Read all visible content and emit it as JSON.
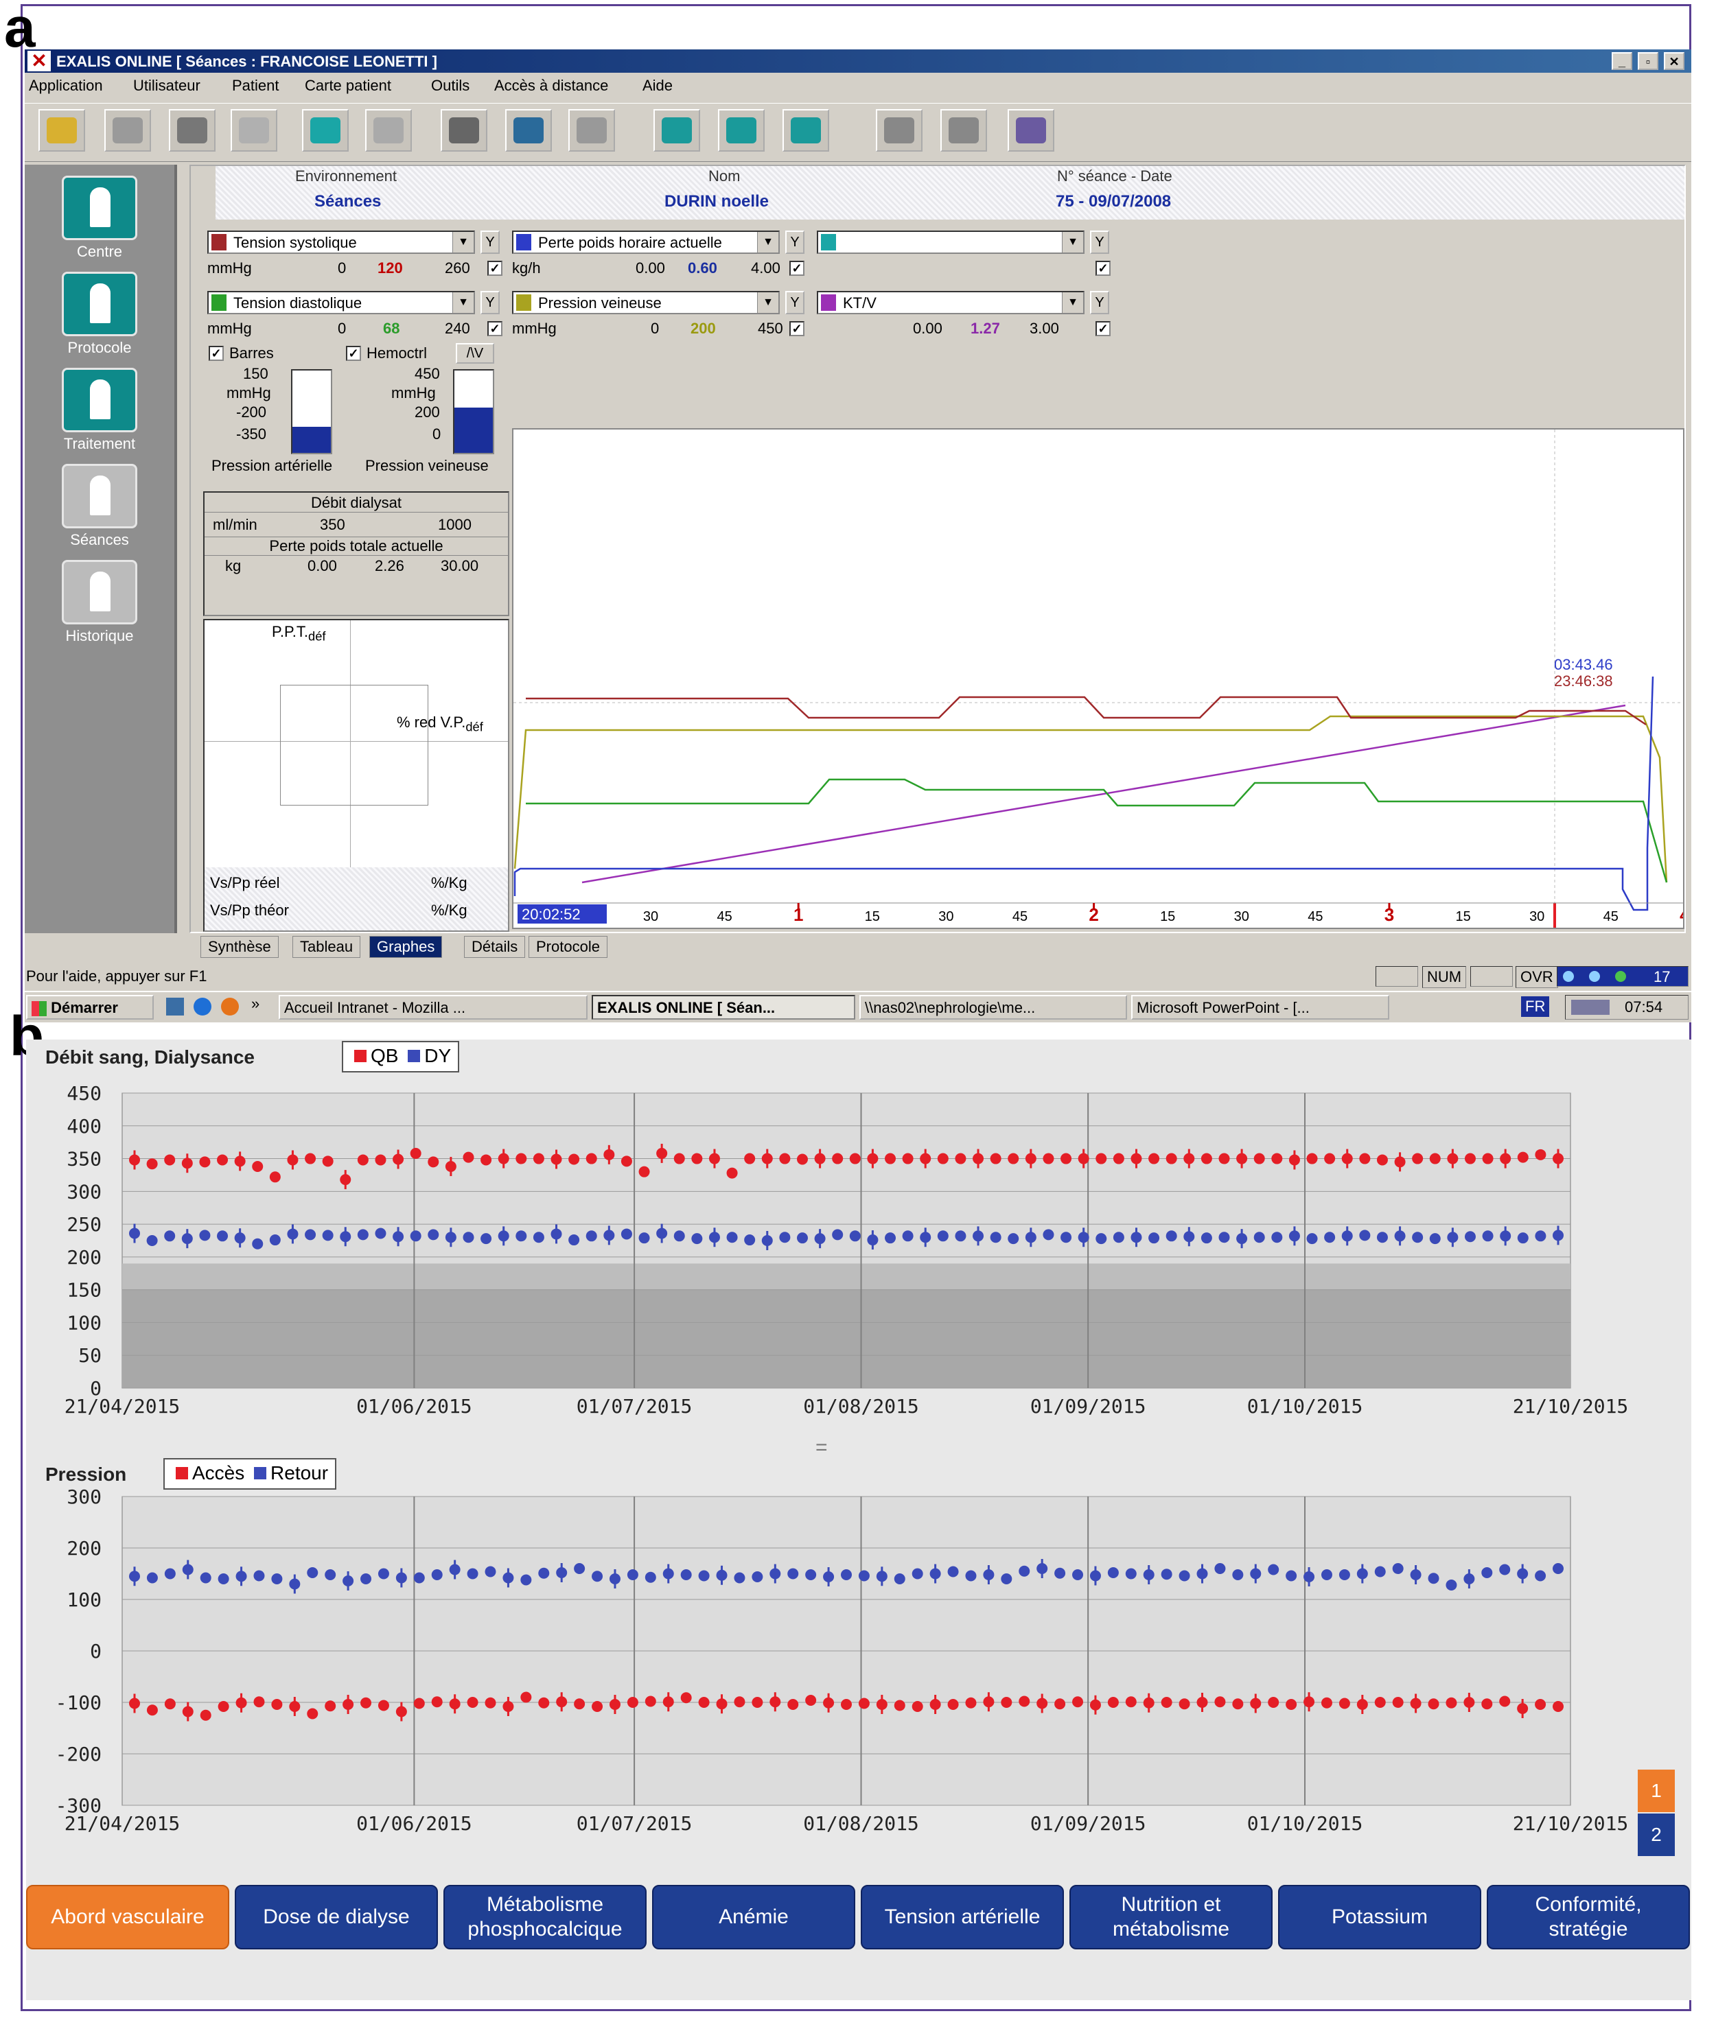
{
  "labels": {
    "a": "a",
    "b": "b"
  },
  "window": {
    "title": "EXALIS ONLINE [ Séances : FRANCOISE LEONETTI ]",
    "min": "_",
    "restore": "▫",
    "close": "✕",
    "menu": [
      "Application",
      "Utilisateur",
      "Patient",
      "Carte patient",
      "Outils",
      "Accès à distance",
      "Aide"
    ]
  },
  "sidebar": {
    "items": [
      {
        "label": "Centre",
        "icon": "centre-icon"
      },
      {
        "label": "Protocole",
        "icon": "protocole-icon"
      },
      {
        "label": "Traitement",
        "icon": "traitement-icon"
      },
      {
        "label": "Séances",
        "icon": "seances-icon"
      },
      {
        "label": "Historique",
        "icon": "historique-icon"
      }
    ]
  },
  "header": {
    "env_label": "Environnement",
    "env_value": "Séances",
    "nom_label": "Nom",
    "nom_value": "DURIN noelle",
    "seance_label": "N° séance - Date",
    "seance_value": "75 - 09/07/2008"
  },
  "params": {
    "systolique": {
      "name": "Tension systolique",
      "unit": "mmHg",
      "min": "0",
      "val": "120",
      "max": "260"
    },
    "diastolique": {
      "name": "Tension diastolique",
      "unit": "mmHg",
      "min": "0",
      "val": "68",
      "max": "240"
    },
    "perte": {
      "name": "Perte poids horaire actuelle",
      "unit": "kg/h",
      "min": "0.00",
      "val": "0.60",
      "max": "4.00"
    },
    "veineuse": {
      "name": "Pression veineuse",
      "unit": "mmHg",
      "min": "0",
      "val": "200",
      "max": "450"
    },
    "ktv": {
      "name": "KT/V",
      "min": "0.00",
      "val": "1.27",
      "max": "3.00"
    },
    "y": "Y",
    "check": "✓"
  },
  "bars": {
    "barres": "Barres",
    "hemoctrl": "Hemoctrl",
    "av": "/\\V",
    "art": {
      "top": "150",
      "unit": "mmHg",
      "mid": "-200",
      "bot": "-350",
      "name": "Pression artérielle",
      "level": 0.32
    },
    "vein": {
      "top": "450",
      "unit": "mmHg",
      "mid": "200",
      "bot": "0",
      "name": "Pression veineuse",
      "level": 0.55
    }
  },
  "dialysat": {
    "title": "Débit dialysat",
    "unit": "ml/min",
    "val": "350",
    "max": "1000",
    "perte_title": "Perte poids totale actuelle",
    "perte_unit": "kg",
    "p1": "0.00",
    "p2": "2.26",
    "p3": "30.00"
  },
  "mini": {
    "ppt": "P.P.T.",
    "ppt_sub": "déf",
    "vp": "% red V.P.",
    "vp_sub": "déf",
    "reel": "Vs/Pp réel",
    "theor": "Vs/Pp théor",
    "unit": "%/Kg"
  },
  "graph": {
    "t1": "03:43.46",
    "t2": "23:46:38",
    "start": "20:02:52",
    "ticks": [
      "30",
      "45",
      "1",
      "15",
      "30",
      "45",
      "2",
      "15",
      "30",
      "45",
      "3",
      "15",
      "30",
      "45",
      "4"
    ],
    "colors": {
      "sys": "#a0282a",
      "ven": "#a9a320",
      "dia": "#2aa02a",
      "ktv": "#9b2fb5",
      "perte": "#2d3cc8"
    }
  },
  "tabs": [
    "Synthèse",
    "Tableau",
    "Graphes",
    "Détails",
    "Protocole"
  ],
  "status": {
    "help": "Pour l'aide, appuyer sur F1",
    "num": "NUM",
    "ovr": "OVR",
    "count": "17"
  },
  "taskbar": {
    "start": "Démarrer",
    "chev": "»",
    "tasks": [
      "Accueil Intranet - Mozilla ...",
      "EXALIS ONLINE [ Séan...",
      "\\\\nas02\\nephrologie\\me...",
      "Microsoft PowerPoint - [..."
    ],
    "lang": "FR",
    "time": "07:54"
  },
  "chart_data": [
    {
      "type": "scatter",
      "title": "Débit sang, Dialysance",
      "legend": [
        "QB",
        "DY"
      ],
      "colors": {
        "QB": "#e41e26",
        "DY": "#3a4ab8"
      },
      "ylim": [
        0,
        450
      ],
      "yticks": [
        "450",
        "400",
        "350",
        "300",
        "250",
        "200",
        "150",
        "100",
        "50",
        "0"
      ],
      "xticks": [
        "21/04/2015",
        "01/06/2015",
        "01/07/2015",
        "01/08/2015",
        "01/09/2015",
        "01/10/2015",
        "21/10/2015"
      ],
      "series": [
        {
          "name": "QB",
          "y": [
            348,
            342,
            348,
            343,
            345,
            348,
            346,
            338,
            322,
            348,
            350,
            346,
            318,
            348,
            348,
            349,
            358,
            345,
            338,
            352,
            348,
            350,
            350,
            350,
            349,
            349,
            350,
            356,
            346,
            330,
            358,
            350,
            350,
            350,
            328,
            350,
            350,
            350,
            349,
            350,
            350,
            350,
            350,
            350,
            350,
            350,
            350,
            350,
            350,
            350,
            350,
            350,
            350,
            350,
            350,
            350,
            350,
            350,
            350,
            350,
            350,
            350,
            350,
            350,
            350,
            350,
            348,
            350,
            350,
            350,
            350,
            348,
            345,
            350,
            350,
            350,
            350,
            350,
            350,
            352,
            356,
            350
          ]
        },
        {
          "name": "DY",
          "y": [
            236,
            225,
            232,
            228,
            233,
            232,
            229,
            220,
            226,
            235,
            234,
            233,
            231,
            234,
            236,
            231,
            232,
            234,
            230,
            230,
            228,
            232,
            232,
            230,
            235,
            226,
            232,
            233,
            235,
            229,
            236,
            232,
            228,
            230,
            230,
            226,
            225,
            230,
            229,
            228,
            234,
            232,
            226,
            229,
            232,
            230,
            232,
            232,
            232,
            230,
            228,
            230,
            234,
            230,
            230,
            228,
            230,
            230,
            229,
            232,
            231,
            229,
            230,
            228,
            230,
            230,
            232,
            228,
            230,
            232,
            233,
            230,
            232,
            230,
            228,
            230,
            231,
            232,
            232,
            229,
            232,
            233
          ]
        }
      ]
    },
    {
      "type": "scatter",
      "title": "Pression",
      "legend": [
        "Accès",
        "Retour"
      ],
      "colors": {
        "Accès": "#e41e26",
        "Retour": "#3a4ab8"
      },
      "ylim": [
        -300,
        300
      ],
      "yticks": [
        "300",
        "200",
        "100",
        "0",
        "-100",
        "-200",
        "-300"
      ],
      "xticks": [
        "21/04/2015",
        "01/06/2015",
        "01/07/2015",
        "01/08/2015",
        "01/09/2015",
        "01/10/2015",
        "21/10/2015"
      ],
      "series": [
        {
          "name": "Accès",
          "y": [
            -102,
            -115,
            -103,
            -118,
            -125,
            -108,
            -101,
            -99,
            -104,
            -108,
            -122,
            -107,
            -104,
            -101,
            -106,
            -118,
            -102,
            -99,
            -103,
            -100,
            -101,
            -108,
            -90,
            -101,
            -99,
            -103,
            -108,
            -104,
            -100,
            -98,
            -99,
            -91,
            -100,
            -103,
            -99,
            -100,
            -99,
            -104,
            -96,
            -101,
            -104,
            -102,
            -104,
            -106,
            -108,
            -104,
            -104,
            -101,
            -99,
            -100,
            -98,
            -102,
            -103,
            -99,
            -105,
            -100,
            -99,
            -101,
            -100,
            -103,
            -100,
            -99,
            -103,
            -102,
            -100,
            -104,
            -99,
            -101,
            -102,
            -104,
            -100,
            -100,
            -102,
            -103,
            -101,
            -100,
            -103,
            -98,
            -112,
            -104,
            -108
          ]
        },
        {
          "name": "Retour",
          "y": [
            145,
            142,
            150,
            158,
            142,
            140,
            145,
            146,
            140,
            130,
            152,
            148,
            136,
            140,
            150,
            142,
            142,
            148,
            158,
            150,
            154,
            142,
            138,
            151,
            152,
            160,
            145,
            140,
            148,
            143,
            150,
            148,
            146,
            147,
            142,
            144,
            150,
            150,
            148,
            144,
            148,
            146,
            145,
            140,
            150,
            150,
            154,
            146,
            148,
            140,
            155,
            160,
            151,
            148,
            146,
            152,
            150,
            148,
            149,
            146,
            150,
            160,
            148,
            150,
            158,
            146,
            144,
            148,
            148,
            150,
            154,
            160,
            148,
            141,
            128,
            140,
            152,
            158,
            150,
            146,
            160
          ]
        }
      ]
    }
  ],
  "bottom_tabs": [
    "Abord vasculaire",
    "Dose de dialyse",
    "Métabolisme\nphosphocalcique",
    "Anémie",
    "Tension artérielle",
    "Nutrition et\nmétabolisme",
    "Potassium",
    "Conformité,\nstratégie"
  ],
  "pager": [
    "1",
    "2"
  ],
  "separator": "="
}
